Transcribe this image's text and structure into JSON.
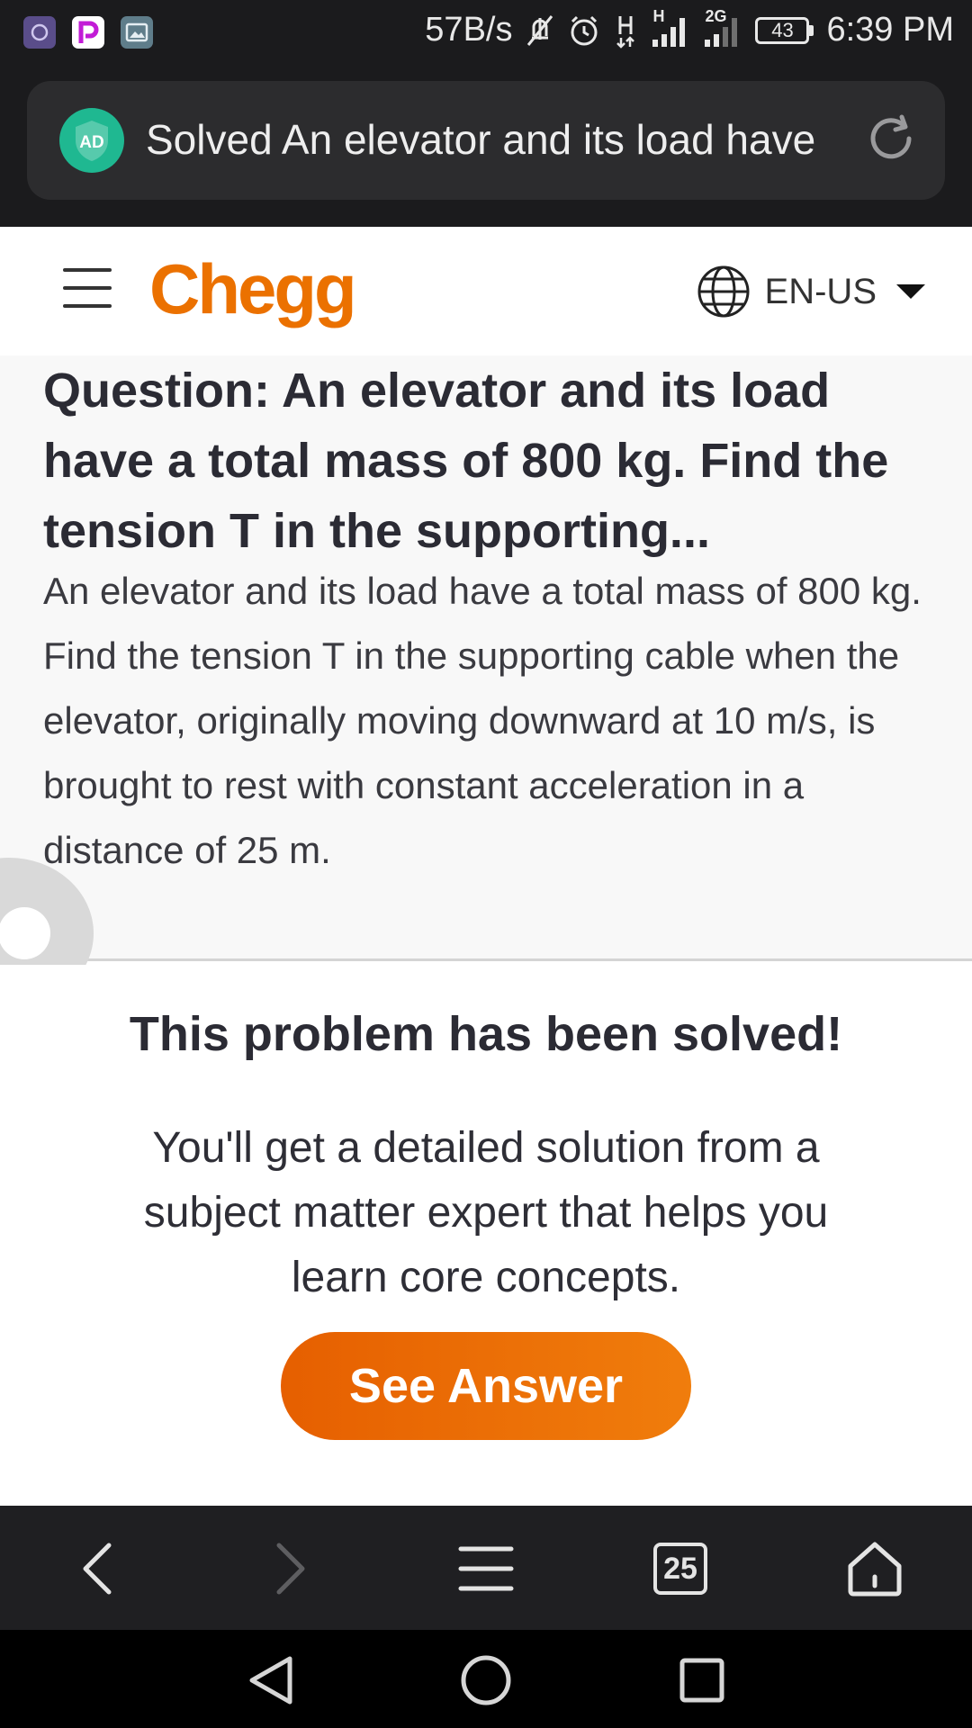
{
  "status_bar": {
    "net_speed": "57B/s",
    "network_1": "H",
    "network_2": "2G",
    "battery": "43",
    "time": "6:39 PM"
  },
  "browser": {
    "ad_badge": "AD",
    "url_title": "Solved An elevator and its load have",
    "tab_count": "25"
  },
  "header": {
    "logo": "Chegg",
    "language": "EN-US"
  },
  "question": {
    "title": "Question: An elevator and its load have a total mass of 800 kg. Find the tension T in the supporting...",
    "body": "An elevator and its load have a total mass of 800 kg. Find the tension T in the supporting cable when the elevator, originally moving downward at 10 m/s, is brought to rest with constant acceleration in a distance of 25 m."
  },
  "solved": {
    "title": "This problem has been solved!",
    "description": "You'll get a detailed solution from a subject matter expert that helps you learn core concepts.",
    "cta": "See Answer"
  },
  "colors": {
    "brand": "#eb7100",
    "ad_shield": "#1fb891"
  }
}
